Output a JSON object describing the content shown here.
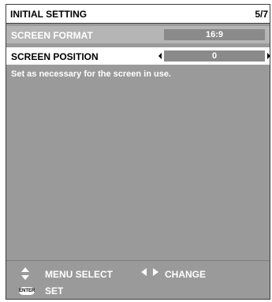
{
  "header": {
    "title": "INITIAL SETTING",
    "page": "5/7"
  },
  "items": [
    {
      "label": "SCREEN FORMAT",
      "value": "16:9"
    },
    {
      "label": "SCREEN POSITION",
      "value": "0"
    }
  ],
  "description": "Set as necessary for the screen in use.",
  "footer": {
    "menu_select": "MENU SELECT",
    "change": "CHANGE",
    "enter_badge": "ENTER",
    "set": "SET"
  },
  "icons": {
    "updown": "up-down-arrows-icon",
    "leftright": "left-right-arrows-icon",
    "enter": "enter-button-icon"
  },
  "colors": {
    "panel_bg": "#9a9a9a",
    "selected_row_bg": "#ffffff",
    "value_box_bg": "#8a8a8a",
    "inactive_row_bg": "#b5b5b5"
  }
}
